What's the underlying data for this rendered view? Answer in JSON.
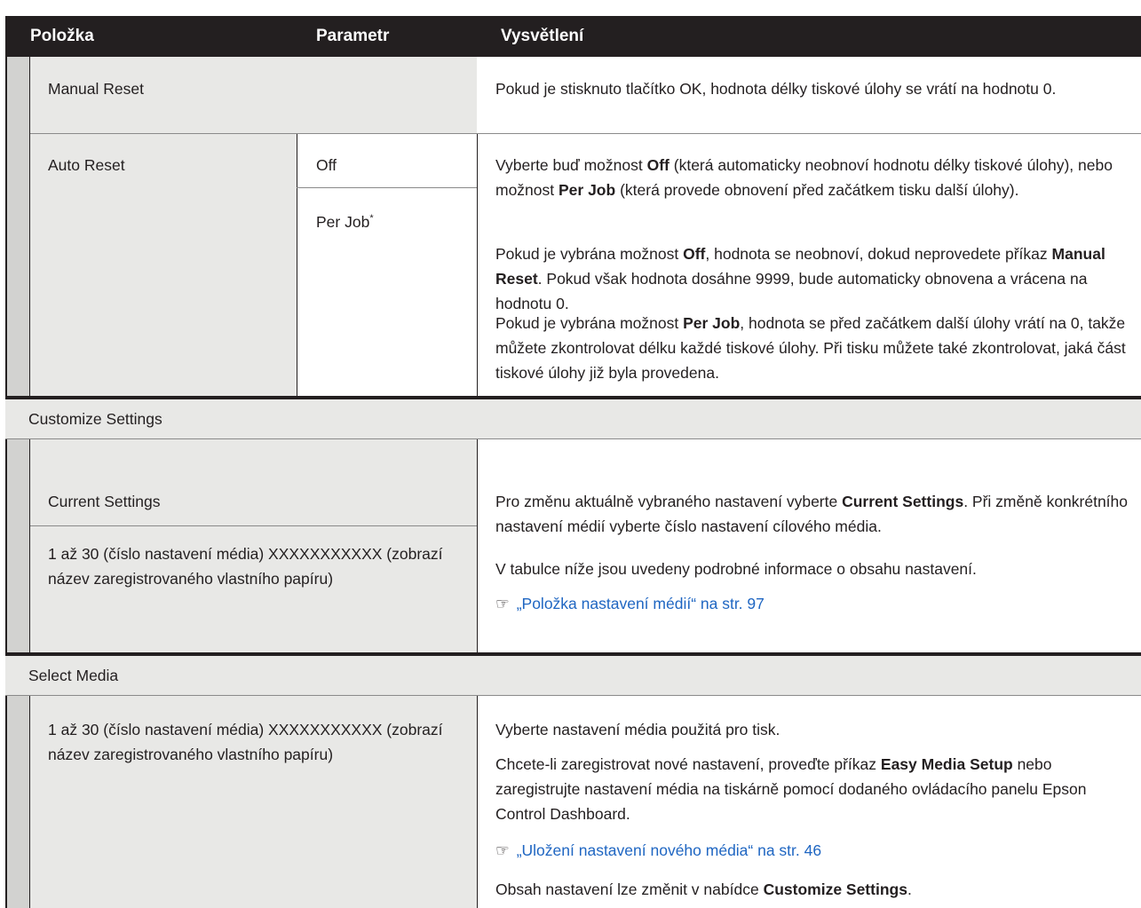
{
  "header": {
    "col1": "Položka",
    "col2": "Parametr",
    "col3": "Vysvětlení"
  },
  "manual_reset": {
    "item": "Manual Reset",
    "desc": "Pokud je stisknuto tlačítko OK, hodnota délky tiskové úlohy se vrátí na hodnotu 0."
  },
  "auto_reset": {
    "item": "Auto Reset",
    "param1": "Off",
    "param2": "Per Job",
    "param2_mark": "*",
    "p1_a": "Vyberte buď možnost ",
    "p1_b": "Off",
    "p1_c": " (která automaticky neobnoví hodnotu délky tiskové úlohy), nebo možnost ",
    "p1_d": "Per Job",
    "p1_e": " (která provede obnovení před začátkem tisku další úlohy).",
    "p2_a": "Pokud je vybrána možnost ",
    "p2_b": "Off",
    "p2_c": ", hodnota se neobnoví, dokud neprovedete příkaz ",
    "p2_d": "Manual Reset",
    "p2_e": ". Pokud však hodnota dosáhne 9999, bude automaticky obnovena a vrácena na hodnotu 0.",
    "p3_a": "Pokud je vybrána možnost ",
    "p3_b": "Per Job",
    "p3_c": ", hodnota se před začátkem další úlohy vrátí na 0, takže můžete zkontrolovat délku každé tiskové úlohy. Při tisku můžete také zkontrolovat, jaká část tiskové úlohy již byla provedena."
  },
  "customize": {
    "section": "Customize Settings",
    "item1": "Current Settings",
    "item2": "1 až 30 (číslo nastavení média) XXXXXXXXXXX (zobrazí název zaregistrovaného vlastního papíru)",
    "p1_a": "Pro změnu aktuálně vybraného nastavení vyberte ",
    "p1_b": "Current Settings",
    "p1_c": ". Při změně konkrétního nastavení médií vyberte číslo nastavení cílového média.",
    "p2": "V tabulce níže jsou uvedeny podrobné informace o obsahu nastavení.",
    "link_icon": "☞",
    "link": "„Položka nastavení médií“ na str. 97"
  },
  "select_media": {
    "section": "Select Media",
    "item": "1 až 30 (číslo nastavení média) XXXXXXXXXXX (zobrazí název zaregistrovaného vlastního papíru)",
    "p1": "Vyberte nastavení média použitá pro tisk.",
    "p2_a": "Chcete-li zaregistrovat nové nastavení, proveďte příkaz ",
    "p2_b": "Easy Media Setup",
    "p2_c": " nebo zaregistrujte nastavení média na tiskárně pomocí dodaného ovládacího panelu Epson Control Dashboard.",
    "link_icon": "☞",
    "link": "„Uložení nastavení nového média“ na str. 46",
    "p3_a": "Obsah nastavení lze změnit v nabídce ",
    "p3_b": "Customize Settings",
    "p3_c": "."
  },
  "colors": {
    "header_bg": "#231f20",
    "cell_gray": "#e8e8e6",
    "indent_gray": "#d2d2d0",
    "link": "#1f66c2"
  }
}
